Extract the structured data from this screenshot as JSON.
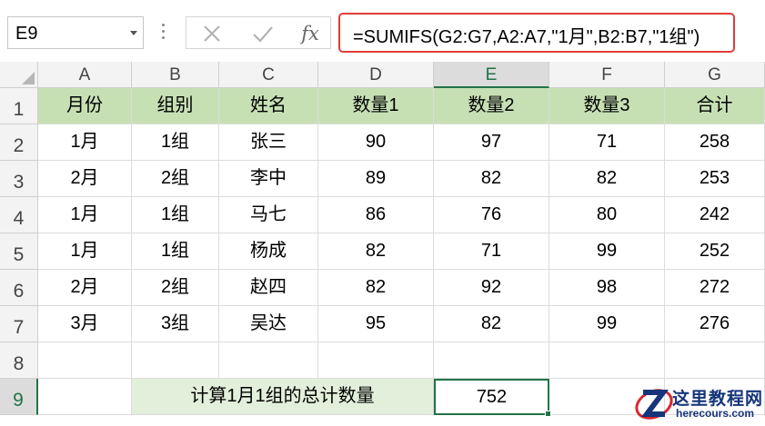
{
  "formula_bar": {
    "name_box": "E9",
    "fx_label": "fx",
    "formula": "=SUMIFS(G2:G7,A2:A7,\"1月\",B2:B7,\"1组\")",
    "highlight_color": "#e03c3c"
  },
  "sheet": {
    "columns": [
      "A",
      "B",
      "C",
      "D",
      "E",
      "F",
      "G"
    ],
    "row_numbers": [
      "1",
      "2",
      "3",
      "4",
      "5",
      "6",
      "7",
      "8",
      "9"
    ],
    "selected_cell": "E9",
    "header_fill": "#c6e0b4",
    "label_fill": "#e2efda",
    "header": [
      "月份",
      "组别",
      "姓名",
      "数量1",
      "数量2",
      "数量3",
      "合计"
    ],
    "rows": [
      [
        "1月",
        "1组",
        "张三",
        "90",
        "97",
        "71",
        "258"
      ],
      [
        "2月",
        "2组",
        "李中",
        "89",
        "82",
        "82",
        "253"
      ],
      [
        "1月",
        "1组",
        "马七",
        "86",
        "76",
        "80",
        "242"
      ],
      [
        "1月",
        "1组",
        "杨成",
        "82",
        "71",
        "99",
        "252"
      ],
      [
        "2月",
        "2组",
        "赵四",
        "82",
        "92",
        "98",
        "272"
      ],
      [
        "3月",
        "3组",
        "吴达",
        "95",
        "82",
        "99",
        "276"
      ]
    ],
    "summary_label": "计算1月1组的总计数量",
    "summary_value": "752"
  },
  "watermark": {
    "title": "这里教程网",
    "url": "herecours.com"
  }
}
